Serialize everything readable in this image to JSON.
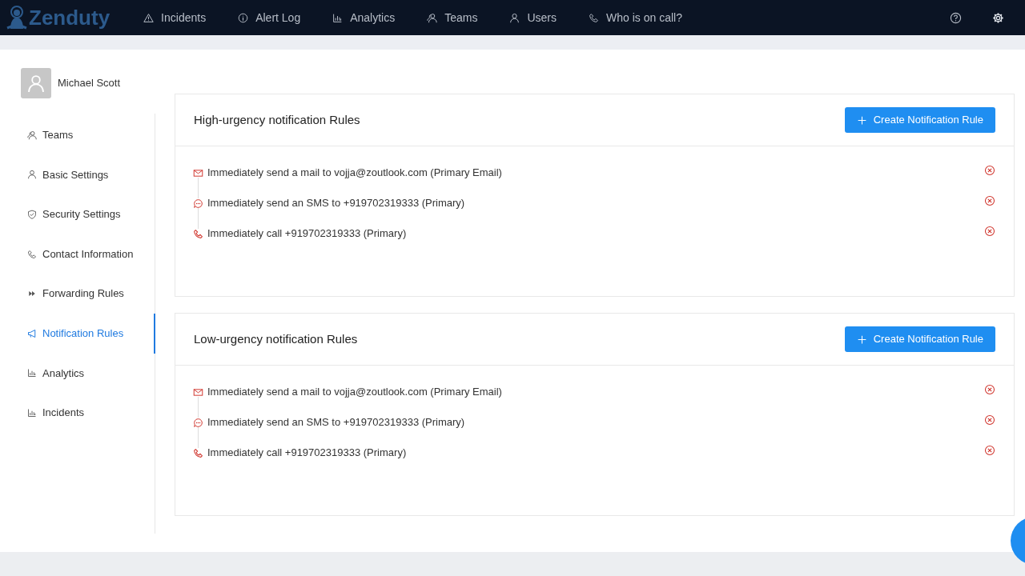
{
  "brand": "Zenduty",
  "nav": [
    {
      "label": "Incidents",
      "kind": "warning"
    },
    {
      "label": "Alert Log",
      "kind": "info"
    },
    {
      "label": "Analytics",
      "kind": "chart"
    },
    {
      "label": "Teams",
      "kind": "people"
    },
    {
      "label": "Users",
      "kind": "person"
    },
    {
      "label": "Who is on call?",
      "kind": "phone"
    }
  ],
  "user": {
    "name": "Michael Scott"
  },
  "sidebar": {
    "items": [
      {
        "label": "Teams",
        "kind": "people",
        "selected": false
      },
      {
        "label": "Basic Settings",
        "kind": "person",
        "selected": false
      },
      {
        "label": "Security Settings",
        "kind": "shield",
        "selected": false
      },
      {
        "label": "Contact Information",
        "kind": "phone",
        "selected": false
      },
      {
        "label": "Forwarding Rules",
        "kind": "forward",
        "selected": false
      },
      {
        "label": "Notification Rules",
        "kind": "megaphone",
        "selected": true
      },
      {
        "label": "Analytics",
        "kind": "chart",
        "selected": false
      },
      {
        "label": "Incidents",
        "kind": "chart",
        "selected": false
      }
    ]
  },
  "sections": [
    {
      "title": "High-urgency notification Rules",
      "button": "Create Notification Rule",
      "rules": [
        {
          "kind": "mail",
          "text": "Immediately send a mail to vojja@zoutlook.com (Primary Email)"
        },
        {
          "kind": "sms",
          "text": "Immediately send an SMS to +919702319333 (Primary)"
        },
        {
          "kind": "call",
          "text": "Immediately call +919702319333 (Primary)"
        }
      ]
    },
    {
      "title": "Low-urgency notification Rules",
      "button": "Create Notification Rule",
      "rules": [
        {
          "kind": "mail",
          "text": "Immediately send a mail to vojja@zoutlook.com (Primary Email)"
        },
        {
          "kind": "sms",
          "text": "Immediately send an SMS to +919702319333 (Primary)"
        },
        {
          "kind": "call",
          "text": "Immediately call +919702319333 (Primary)"
        }
      ]
    }
  ]
}
